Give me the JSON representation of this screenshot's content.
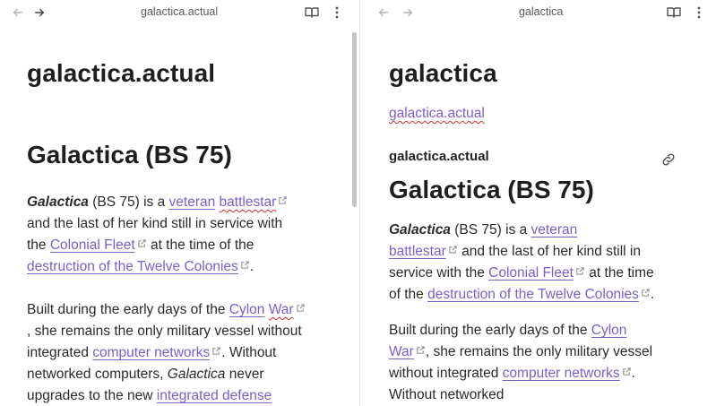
{
  "left_pane": {
    "tab_title": "galactica.actual",
    "page_title": "galactica.actual",
    "article_heading": "Galactica (BS 75)",
    "para1": {
      "l1_bold_italic": "Galactica",
      "l1_text": " (BS 75) is a ",
      "l1_link_a": "veteran",
      "l1_link_b": "battlestar",
      "l2_text": " and the last of her kind still in service with",
      "l3_text_a": "the ",
      "l3_link": "Colonial Fleet",
      "l3_text_b": " at the time of the",
      "l4_link": "destruction of the Twelve Colonies",
      "l4_text": "."
    },
    "para2": {
      "l1_text": "Built during the early days of the ",
      "l1_link_a": "Cylon",
      "l1_link_b": "War",
      "l2_text": ", she remains the only military vessel without",
      "l3_text_a": "integrated ",
      "l3_link": "computer networks",
      "l3_text_b": ". Without",
      "l4_text_a": "networked computers, ",
      "l4_italic": "Galactica",
      "l4_text_b": " never",
      "l5_text": "upgrades to the new ",
      "l5_link": "integrated defense"
    }
  },
  "right_pane": {
    "tab_title": "galactica",
    "page_title": "galactica",
    "backlink": "galactica.actual",
    "embed_title": "galactica.actual",
    "article_heading": "Galactica (BS 75)",
    "para1": {
      "l1_bold_italic": "Galactica",
      "l1_text": " (BS 75) is a ",
      "l1_link": "veteran",
      "l2_link": "battlestar",
      "l2_text": " and the last of her kind still in",
      "l3_text_a": "service with the ",
      "l3_link": "Colonial Fleet",
      "l3_text_b": " at the time",
      "l4_text_a": "of the ",
      "l4_link": "destruction of the Twelve Colonies",
      "l4_text_b": "."
    },
    "para2": {
      "l1_text": "Built during the early days of the ",
      "l1_link": "Cylon",
      "l2_link": "War",
      "l2_text": ", she remains the only military vessel",
      "l3_text_a": "without integrated ",
      "l3_link": "computer networks",
      "l3_text_b": ".",
      "l4_text": "Without networked"
    }
  },
  "icons": {
    "back": "arrow-left-icon",
    "forward": "arrow-right-icon",
    "reader": "book-open-icon",
    "more": "more-vertical-icon",
    "external": "external-link-icon",
    "link": "link-icon"
  },
  "colors": {
    "link": "#7b5fc7",
    "spellcheck": "#e03030",
    "text": "#222222",
    "divider": "#e3e3e3"
  }
}
